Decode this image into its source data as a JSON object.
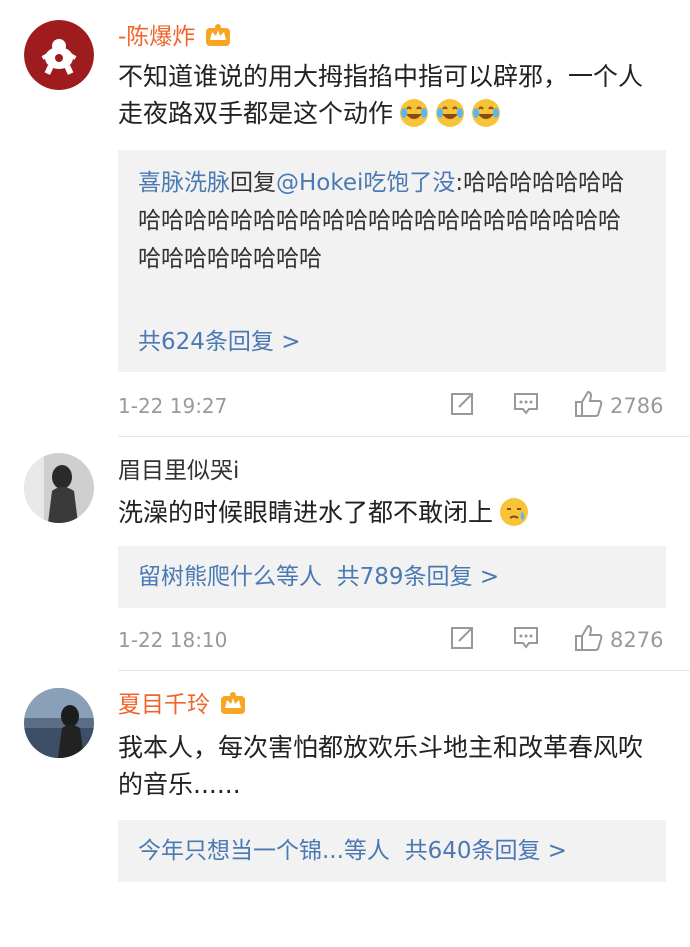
{
  "comments": [
    {
      "username": "-陈爆炸",
      "text": "不知道谁说的用大拇指掐中指可以辟邪，一个人走夜路双手都是这个动作",
      "emojis": [
        "laugh-cry-emoji",
        "laugh-cry-emoji",
        "laugh-cry-emoji"
      ],
      "reply": {
        "from": "喜脉洗脉",
        "verb": "回复",
        "to": "@Hokei吃饱了没",
        "text": ":哈哈哈哈哈哈哈哈哈哈哈哈哈哈哈哈哈哈哈哈哈哈哈哈哈哈哈哈哈哈哈哈哈哈哈哈",
        "more": "共624条回复 >"
      },
      "time": "1-22 19:27",
      "likes": "2786"
    },
    {
      "username": "眉目里似哭i",
      "text": "洗澡的时候眼睛进水了都不敢闭上",
      "emojis": [
        "sweat-emoji"
      ],
      "reply": {
        "users": "留树熊爬什么等人",
        "more": "共789条回复 >"
      },
      "time": "1-22 18:10",
      "likes": "8276"
    },
    {
      "username": "夏目千玲",
      "text": "我本人，每次害怕都放欢乐斗地主和改革春风吹的音乐......",
      "reply": {
        "users": "今年只想当一个锦...等人",
        "more": "共640条回复 >"
      }
    }
  ],
  "colors": {
    "vip_name": "#f1642b",
    "link": "#4a79b3",
    "meta": "#999999",
    "reply_bg": "#f2f2f2"
  }
}
